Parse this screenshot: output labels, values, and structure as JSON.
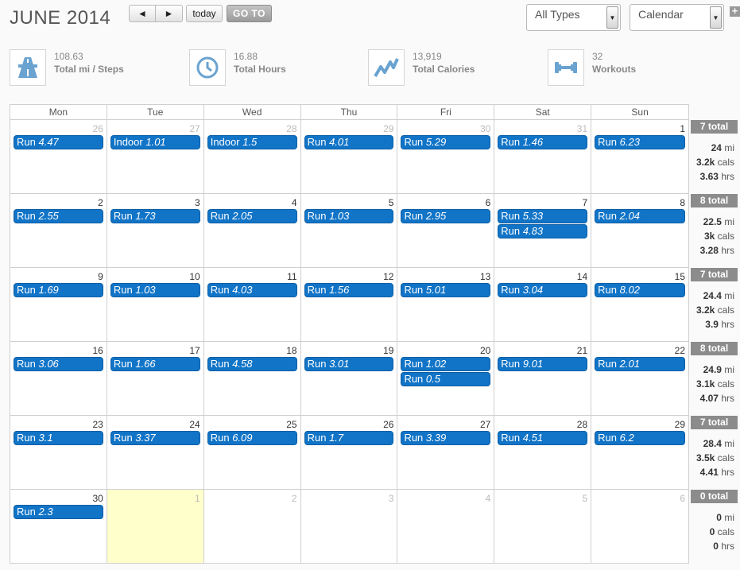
{
  "header": {
    "title": "JUNE 2014",
    "prev_label": "◄",
    "next_label": "►",
    "today_label": "today",
    "goto_label": "GO TO",
    "type_select": "All Types",
    "view_select": "Calendar",
    "add_label": "+"
  },
  "stats": [
    {
      "value": "108.63",
      "label": "Total mi / Steps",
      "icon": "road-icon"
    },
    {
      "value": "16.88",
      "label": "Total Hours",
      "icon": "clock-icon"
    },
    {
      "value": "13,919",
      "label": "Total Calories",
      "icon": "trend-icon"
    },
    {
      "value": "32",
      "label": "Workouts",
      "icon": "dumbbell-icon"
    }
  ],
  "weekdays": [
    "Mon",
    "Tue",
    "Wed",
    "Thu",
    "Fri",
    "Sat",
    "Sun"
  ],
  "weeks": [
    {
      "days": [
        {
          "num": "26",
          "other": true,
          "events": [
            {
              "type": "Run",
              "val": "4.47"
            }
          ]
        },
        {
          "num": "27",
          "other": true,
          "events": [
            {
              "type": "Indoor",
              "val": "1.01"
            }
          ]
        },
        {
          "num": "28",
          "other": true,
          "events": [
            {
              "type": "Indoor",
              "val": "1.5"
            }
          ]
        },
        {
          "num": "29",
          "other": true,
          "events": [
            {
              "type": "Run",
              "val": "4.01"
            }
          ]
        },
        {
          "num": "30",
          "other": true,
          "events": [
            {
              "type": "Run",
              "val": "5.29"
            }
          ]
        },
        {
          "num": "31",
          "other": true,
          "events": [
            {
              "type": "Run",
              "val": "1.46"
            }
          ]
        },
        {
          "num": "1",
          "events": [
            {
              "type": "Run",
              "val": "6.23"
            }
          ]
        }
      ],
      "totals": {
        "count": "7 total",
        "mi": "24",
        "cals": "3.2k",
        "hrs": "3.63"
      }
    },
    {
      "days": [
        {
          "num": "2",
          "events": [
            {
              "type": "Run",
              "val": "2.55"
            }
          ]
        },
        {
          "num": "3",
          "events": [
            {
              "type": "Run",
              "val": "1.73"
            }
          ]
        },
        {
          "num": "4",
          "events": [
            {
              "type": "Run",
              "val": "2.05"
            }
          ]
        },
        {
          "num": "5",
          "events": [
            {
              "type": "Run",
              "val": "1.03"
            }
          ]
        },
        {
          "num": "6",
          "events": [
            {
              "type": "Run",
              "val": "2.95"
            }
          ]
        },
        {
          "num": "7",
          "events": [
            {
              "type": "Run",
              "val": "5.33"
            },
            {
              "type": "Run",
              "val": "4.83"
            }
          ]
        },
        {
          "num": "8",
          "events": [
            {
              "type": "Run",
              "val": "2.04"
            }
          ]
        }
      ],
      "totals": {
        "count": "8 total",
        "mi": "22.5",
        "cals": "3k",
        "hrs": "3.28"
      }
    },
    {
      "days": [
        {
          "num": "9",
          "events": [
            {
              "type": "Run",
              "val": "1.69"
            }
          ]
        },
        {
          "num": "10",
          "events": [
            {
              "type": "Run",
              "val": "1.03"
            }
          ]
        },
        {
          "num": "11",
          "events": [
            {
              "type": "Run",
              "val": "4.03"
            }
          ]
        },
        {
          "num": "12",
          "events": [
            {
              "type": "Run",
              "val": "1.56"
            }
          ]
        },
        {
          "num": "13",
          "events": [
            {
              "type": "Run",
              "val": "5.01"
            }
          ]
        },
        {
          "num": "14",
          "events": [
            {
              "type": "Run",
              "val": "3.04"
            }
          ]
        },
        {
          "num": "15",
          "events": [
            {
              "type": "Run",
              "val": "8.02"
            }
          ]
        }
      ],
      "totals": {
        "count": "7 total",
        "mi": "24.4",
        "cals": "3.2k",
        "hrs": "3.9"
      }
    },
    {
      "days": [
        {
          "num": "16",
          "events": [
            {
              "type": "Run",
              "val": "3.06"
            }
          ]
        },
        {
          "num": "17",
          "events": [
            {
              "type": "Run",
              "val": "1.66"
            }
          ]
        },
        {
          "num": "18",
          "events": [
            {
              "type": "Run",
              "val": "4.58"
            }
          ]
        },
        {
          "num": "19",
          "events": [
            {
              "type": "Run",
              "val": "3.01"
            }
          ]
        },
        {
          "num": "20",
          "events": [
            {
              "type": "Run",
              "val": "1.02"
            },
            {
              "type": "Run",
              "val": "0.5"
            }
          ]
        },
        {
          "num": "21",
          "events": [
            {
              "type": "Run",
              "val": "9.01"
            }
          ]
        },
        {
          "num": "22",
          "events": [
            {
              "type": "Run",
              "val": "2.01"
            }
          ]
        }
      ],
      "totals": {
        "count": "8 total",
        "mi": "24.9",
        "cals": "3.1k",
        "hrs": "4.07"
      }
    },
    {
      "days": [
        {
          "num": "23",
          "events": [
            {
              "type": "Run",
              "val": "3.1"
            }
          ]
        },
        {
          "num": "24",
          "events": [
            {
              "type": "Run",
              "val": "3.37"
            }
          ]
        },
        {
          "num": "25",
          "events": [
            {
              "type": "Run",
              "val": "6.09"
            }
          ]
        },
        {
          "num": "26",
          "events": [
            {
              "type": "Run",
              "val": "1.7"
            }
          ]
        },
        {
          "num": "27",
          "events": [
            {
              "type": "Run",
              "val": "3.39"
            }
          ]
        },
        {
          "num": "28",
          "events": [
            {
              "type": "Run",
              "val": "4.51"
            }
          ]
        },
        {
          "num": "29",
          "events": [
            {
              "type": "Run",
              "val": "6.2"
            }
          ]
        }
      ],
      "totals": {
        "count": "7 total",
        "mi": "28.4",
        "cals": "3.5k",
        "hrs": "4.41"
      }
    },
    {
      "days": [
        {
          "num": "30",
          "events": [
            {
              "type": "Run",
              "val": "2.3"
            }
          ]
        },
        {
          "num": "1",
          "other": true,
          "today": true,
          "events": []
        },
        {
          "num": "2",
          "other": true,
          "events": []
        },
        {
          "num": "3",
          "other": true,
          "events": []
        },
        {
          "num": "4",
          "other": true,
          "events": []
        },
        {
          "num": "5",
          "other": true,
          "events": []
        },
        {
          "num": "6",
          "other": true,
          "events": []
        }
      ],
      "totals": {
        "count": "0 total",
        "mi": "0",
        "cals": "0",
        "hrs": "0"
      }
    }
  ],
  "units": {
    "mi": "mi",
    "cals": "cals",
    "hrs": "hrs"
  },
  "colors": {
    "event": "#1174c7",
    "total_badge": "#8c8c8c",
    "today_bg": "#ffffcc",
    "icon": "#6aa3d0"
  }
}
